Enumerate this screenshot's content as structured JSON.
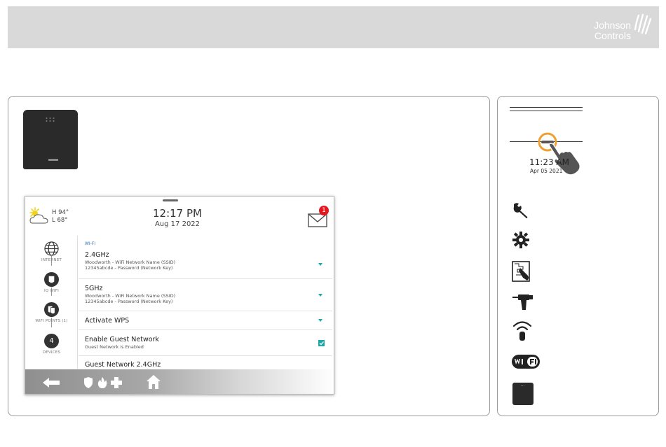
{
  "brand": {
    "line1": "Johnson",
    "line2": "Controls"
  },
  "main_panel": {
    "screen": {
      "weather": {
        "high": "H 94°",
        "low": "L 68°",
        "icon": "partly-cloudy-icon"
      },
      "clock": {
        "time": "12:17 PM",
        "date": "Aug 17 2022"
      },
      "messages": {
        "icon": "envelope-icon",
        "badge_count": "1"
      },
      "nav": [
        {
          "label": "INTERNET",
          "icon": "globe-icon"
        },
        {
          "label": "IQ WIFI",
          "icon": "wifi-shield-icon"
        },
        {
          "label": "WIFI POINTS (1)",
          "icon": "wifi-points-icon"
        },
        {
          "label": "DEVICES",
          "count": "4"
        }
      ],
      "section_title": "WI-FI",
      "rows": [
        {
          "title": "2.4GHz",
          "sub1": "Woodworth - WiFi Network Name (SSID)",
          "sub2": "12345abcde - Password (Network Key)",
          "control": "dropdown"
        },
        {
          "title": "5GHz",
          "sub1": "Woodworth - WiFi Network Name (SSID)",
          "sub2": "12345abcde - Password (Network Key)",
          "control": "dropdown"
        },
        {
          "title": "Activate WPS",
          "control": "dropdown"
        },
        {
          "title": "Enable Guest Network",
          "sub1": "Guest Network is Enabled",
          "control": "checkbox",
          "checked": true
        },
        {
          "title": "Guest Network 2.4GHz"
        }
      ],
      "bottom_bar": {
        "icons": [
          "back-arrow-icon",
          "shield-icon",
          "fire-icon",
          "medical-plus-icon",
          "home-icon"
        ]
      }
    }
  },
  "side_panel": {
    "time": "11:23 AM",
    "date": "Apr 05 2021",
    "icons": [
      "wrench-icon",
      "gear-icon",
      "panel-touch-icon",
      "drill-icon",
      "wireless-sensor-icon",
      "wifi-badge-icon",
      "device-icon"
    ]
  },
  "colors": {
    "accent": "#1ba8a8",
    "badge": "#e4161e",
    "highlight_ring": "#f0a030"
  }
}
